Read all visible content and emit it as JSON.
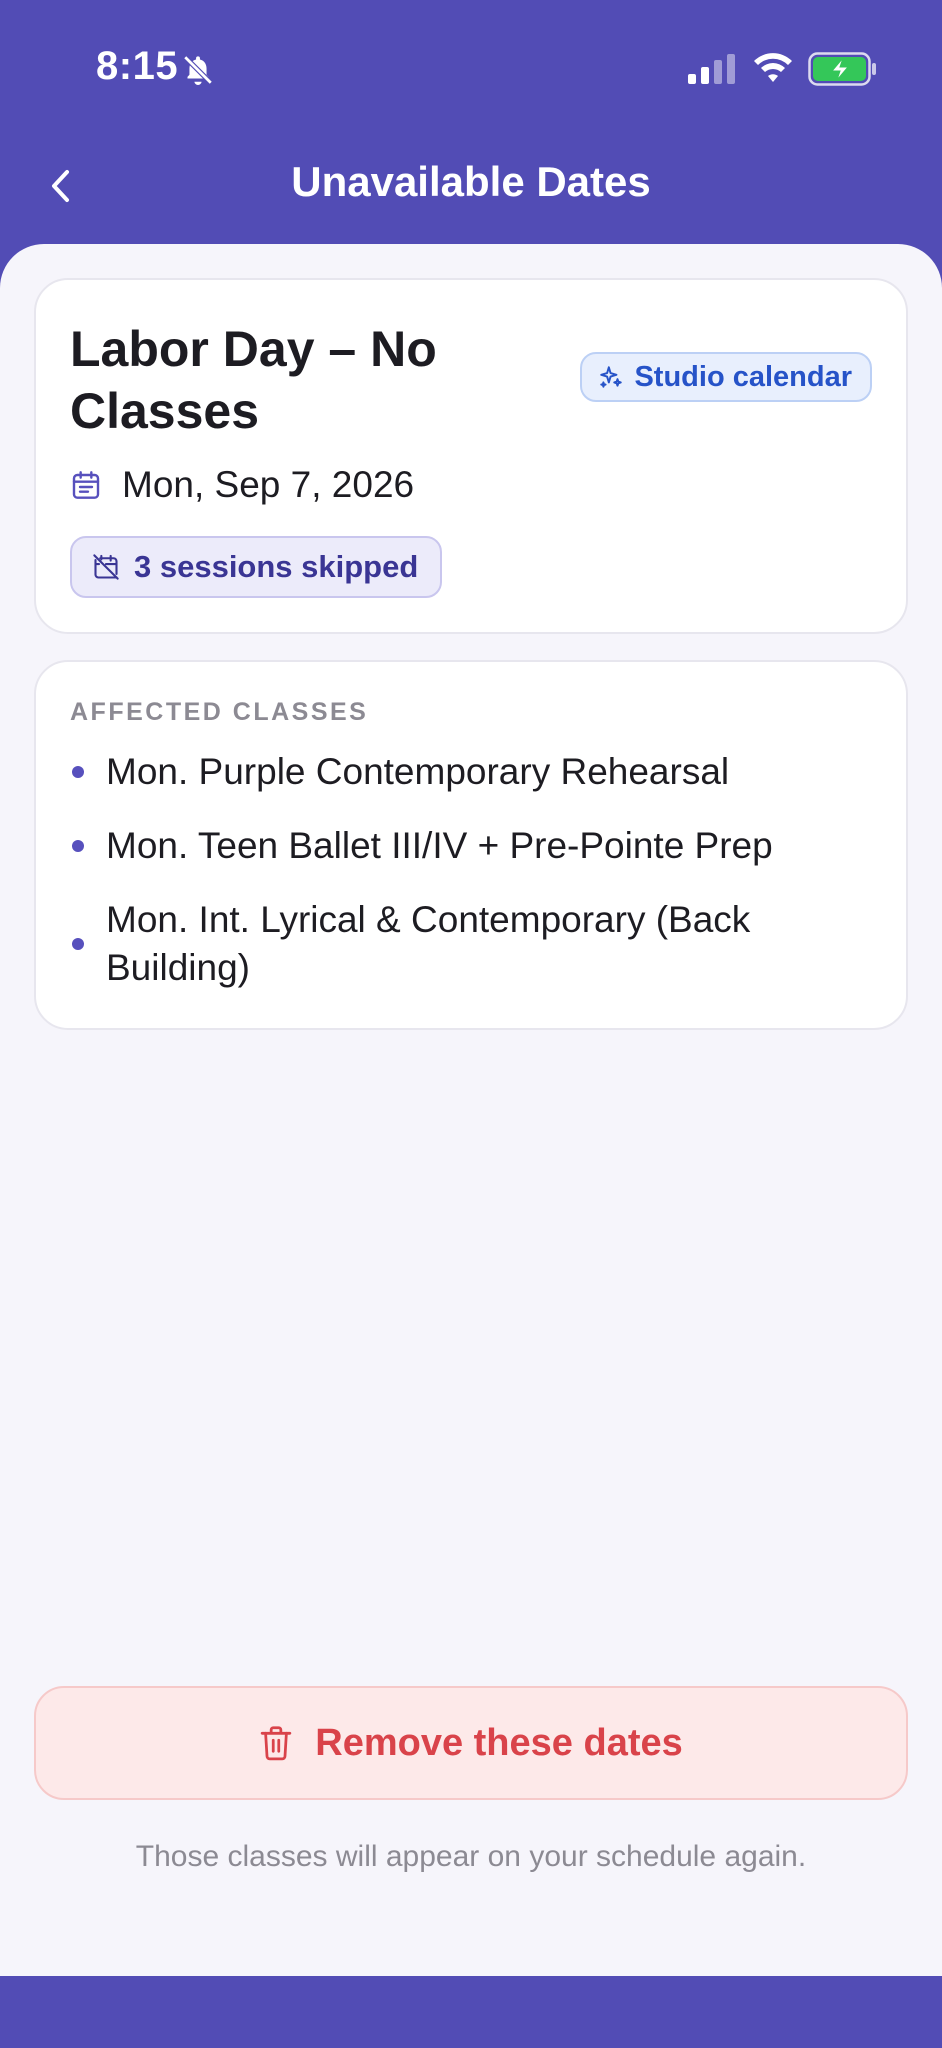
{
  "status_bar": {
    "time": "8:15",
    "icons": [
      "bell-slash-icon",
      "cellular-signal-icon",
      "wifi-icon",
      "battery-charging-icon"
    ],
    "battery_color": "#34c759"
  },
  "nav": {
    "title": "Unavailable Dates",
    "back_icon": "chevron-left-icon"
  },
  "event": {
    "title": "Labor Day – No Classes",
    "source_badge": "Studio calendar",
    "source_icon": "sparkles-icon",
    "date": "Mon, Sep 7, 2026",
    "date_icon": "calendar-icon",
    "skipped_badge": "3 sessions skipped",
    "skipped_icon": "calendar-off-icon"
  },
  "affected": {
    "label": "AFFECTED CLASSES",
    "classes": [
      "Mon. Purple Contemporary Rehearsal",
      "Mon. Teen Ballet III/IV + Pre-Pointe Prep",
      "Mon. Int. Lyrical & Contemporary (Back Building)"
    ]
  },
  "actions": {
    "remove_label": "Remove these dates",
    "remove_icon": "trash-icon",
    "helper_text": "Those classes will appear on your schedule again."
  },
  "colors": {
    "brand": "#524cb5",
    "danger": "#d9434a",
    "danger_bg": "#fde9e9",
    "badge_blue": "#2653c8",
    "badge_purple": "#3a3594"
  }
}
